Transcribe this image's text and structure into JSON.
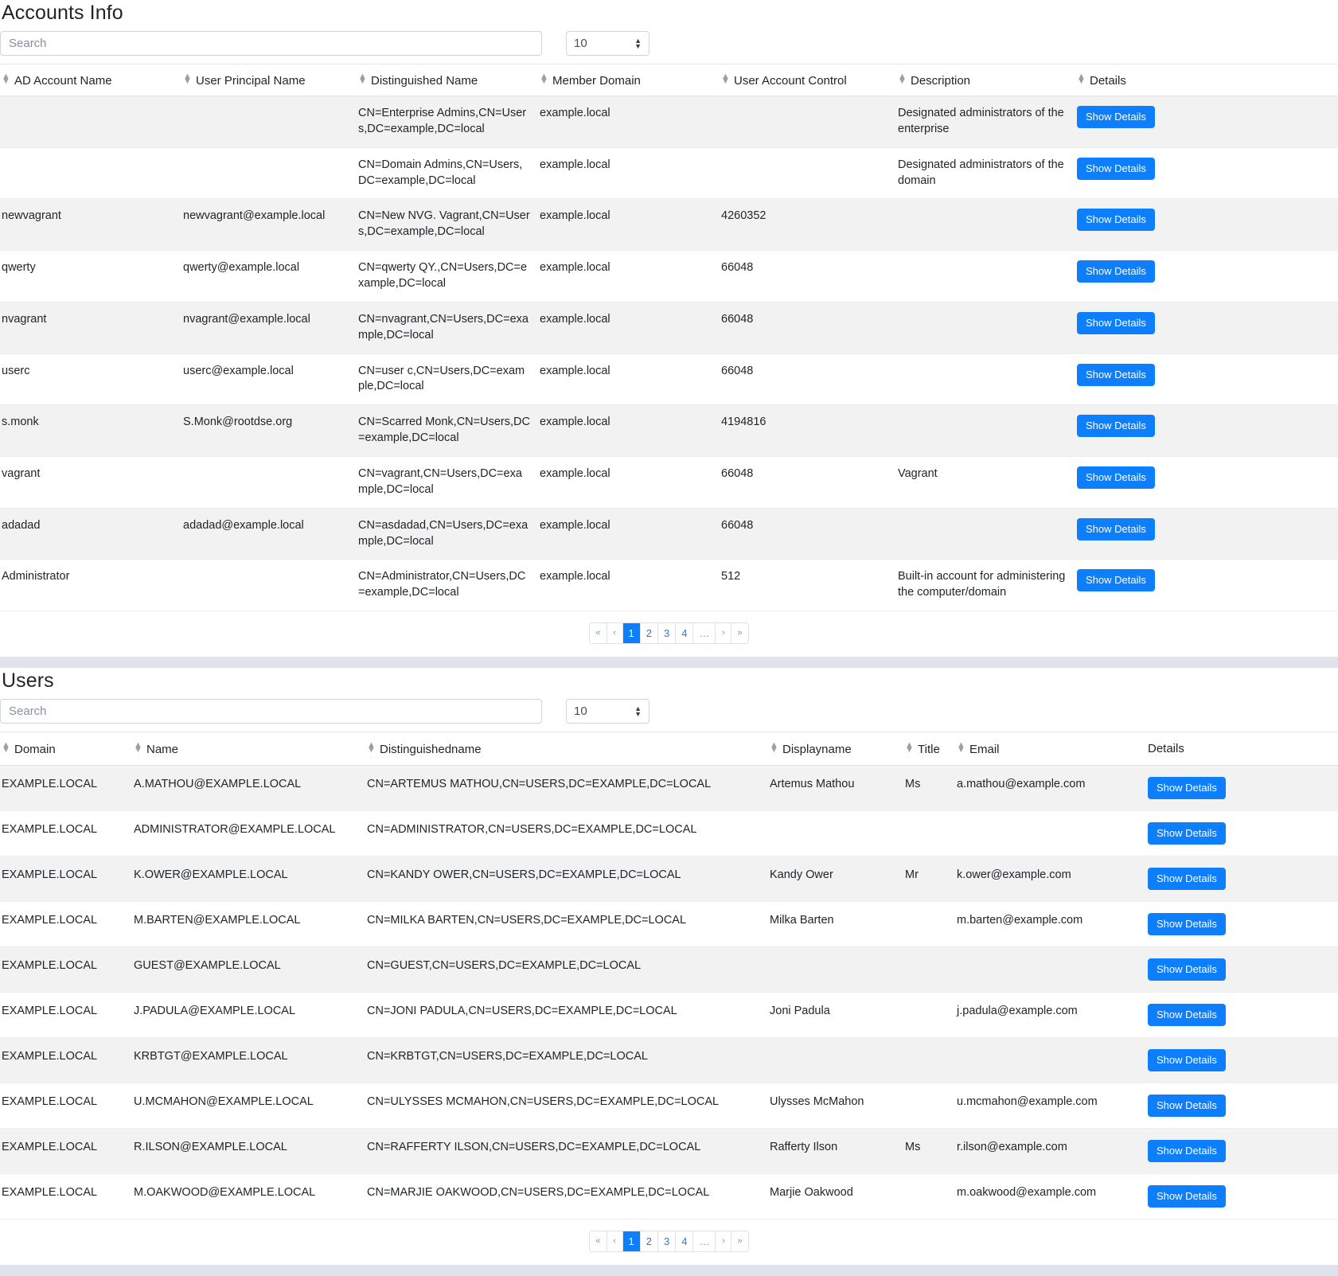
{
  "accounts": {
    "title": "Accounts Info",
    "search_placeholder": "Search",
    "page_size": "10",
    "columns": [
      "AD Account Name",
      "User Principal Name",
      "Distinguished Name",
      "Member Domain",
      "User Account Control",
      "Description",
      "Details"
    ],
    "details_label": "Show Details",
    "rows": [
      {
        "ad_account_name": "",
        "user_principal_name": "",
        "distinguished_name": "CN=Enterprise Admins,CN=Users,DC=example,DC=local",
        "member_domain": "example.local",
        "user_account_control": "",
        "description": "Designated administrators of the enterprise"
      },
      {
        "ad_account_name": "",
        "user_principal_name": "",
        "distinguished_name": "CN=Domain Admins,CN=Users,DC=example,DC=local",
        "member_domain": "example.local",
        "user_account_control": "",
        "description": "Designated administrators of the domain"
      },
      {
        "ad_account_name": "newvagrant",
        "user_principal_name": "newvagrant@example.local",
        "distinguished_name": "CN=New NVG. Vagrant,CN=Users,DC=example,DC=local",
        "member_domain": "example.local",
        "user_account_control": "4260352",
        "description": ""
      },
      {
        "ad_account_name": "qwerty",
        "user_principal_name": "qwerty@example.local",
        "distinguished_name": "CN=qwerty QY.,CN=Users,DC=example,DC=local",
        "member_domain": "example.local",
        "user_account_control": "66048",
        "description": ""
      },
      {
        "ad_account_name": "nvagrant",
        "user_principal_name": "nvagrant@example.local",
        "distinguished_name": "CN=nvagrant,CN=Users,DC=example,DC=local",
        "member_domain": "example.local",
        "user_account_control": "66048",
        "description": ""
      },
      {
        "ad_account_name": "userc",
        "user_principal_name": "userc@example.local",
        "distinguished_name": "CN=user c,CN=Users,DC=example,DC=local",
        "member_domain": "example.local",
        "user_account_control": "66048",
        "description": ""
      },
      {
        "ad_account_name": "s.monk",
        "user_principal_name": "S.Monk@rootdse.org",
        "distinguished_name": "CN=Scarred Monk,CN=Users,DC=example,DC=local",
        "member_domain": "example.local",
        "user_account_control": "4194816",
        "description": ""
      },
      {
        "ad_account_name": "vagrant",
        "user_principal_name": "",
        "distinguished_name": "CN=vagrant,CN=Users,DC=example,DC=local",
        "member_domain": "example.local",
        "user_account_control": "66048",
        "description": "Vagrant"
      },
      {
        "ad_account_name": "adadad",
        "user_principal_name": "adadad@example.local",
        "distinguished_name": "CN=asdadad,CN=Users,DC=example,DC=local",
        "member_domain": "example.local",
        "user_account_control": "66048",
        "description": ""
      },
      {
        "ad_account_name": "Administrator",
        "user_principal_name": "",
        "distinguished_name": "CN=Administrator,CN=Users,DC=example,DC=local",
        "member_domain": "example.local",
        "user_account_control": "512",
        "description": "Built-in account for administering the computer/domain"
      }
    ],
    "pagination": {
      "first": "«",
      "prev": "‹",
      "pages": [
        "1",
        "2",
        "3",
        "4"
      ],
      "ellipsis": "…",
      "next": "›",
      "last": "»",
      "active": "1"
    }
  },
  "users": {
    "title": "Users",
    "search_placeholder": "Search",
    "page_size": "10",
    "columns": [
      "Domain",
      "Name",
      "Distinguishedname",
      "Displayname",
      "Title",
      "Email",
      "Details"
    ],
    "details_label": "Show Details",
    "rows": [
      {
        "domain": "EXAMPLE.LOCAL",
        "name": "A.MATHOU@EXAMPLE.LOCAL",
        "distinguishedname": "CN=ARTEMUS MATHOU,CN=USERS,DC=EXAMPLE,DC=LOCAL",
        "displayname": "Artemus Mathou",
        "title": "Ms",
        "email": "a.mathou@example.com"
      },
      {
        "domain": "EXAMPLE.LOCAL",
        "name": "ADMINISTRATOR@EXAMPLE.LOCAL",
        "distinguishedname": "CN=ADMINISTRATOR,CN=USERS,DC=EXAMPLE,DC=LOCAL",
        "displayname": "",
        "title": "",
        "email": ""
      },
      {
        "domain": "EXAMPLE.LOCAL",
        "name": "K.OWER@EXAMPLE.LOCAL",
        "distinguishedname": "CN=KANDY OWER,CN=USERS,DC=EXAMPLE,DC=LOCAL",
        "displayname": "Kandy Ower",
        "title": "Mr",
        "email": "k.ower@example.com"
      },
      {
        "domain": "EXAMPLE.LOCAL",
        "name": "M.BARTEN@EXAMPLE.LOCAL",
        "distinguishedname": "CN=MILKA BARTEN,CN=USERS,DC=EXAMPLE,DC=LOCAL",
        "displayname": "Milka Barten",
        "title": "",
        "email": "m.barten@example.com"
      },
      {
        "domain": "EXAMPLE.LOCAL",
        "name": "GUEST@EXAMPLE.LOCAL",
        "distinguishedname": "CN=GUEST,CN=USERS,DC=EXAMPLE,DC=LOCAL",
        "displayname": "",
        "title": "",
        "email": ""
      },
      {
        "domain": "EXAMPLE.LOCAL",
        "name": "J.PADULA@EXAMPLE.LOCAL",
        "distinguishedname": "CN=JONI PADULA,CN=USERS,DC=EXAMPLE,DC=LOCAL",
        "displayname": "Joni Padula",
        "title": "",
        "email": "j.padula@example.com"
      },
      {
        "domain": "EXAMPLE.LOCAL",
        "name": "KRBTGT@EXAMPLE.LOCAL",
        "distinguishedname": "CN=KRBTGT,CN=USERS,DC=EXAMPLE,DC=LOCAL",
        "displayname": "",
        "title": "",
        "email": ""
      },
      {
        "domain": "EXAMPLE.LOCAL",
        "name": "U.MCMAHON@EXAMPLE.LOCAL",
        "distinguishedname": "CN=ULYSSES MCMAHON,CN=USERS,DC=EXAMPLE,DC=LOCAL",
        "displayname": "Ulysses McMahon",
        "title": "",
        "email": "u.mcmahon@example.com"
      },
      {
        "domain": "EXAMPLE.LOCAL",
        "name": "R.ILSON@EXAMPLE.LOCAL",
        "distinguishedname": "CN=RAFFERTY ILSON,CN=USERS,DC=EXAMPLE,DC=LOCAL",
        "displayname": "Rafferty Ilson",
        "title": "Ms",
        "email": "r.ilson@example.com"
      },
      {
        "domain": "EXAMPLE.LOCAL",
        "name": "M.OAKWOOD@EXAMPLE.LOCAL",
        "distinguishedname": "CN=MARJIE OAKWOOD,CN=USERS,DC=EXAMPLE,DC=LOCAL",
        "displayname": "Marjie Oakwood",
        "title": "",
        "email": "m.oakwood@example.com"
      }
    ],
    "pagination": {
      "first": "«",
      "prev": "‹",
      "pages": [
        "1",
        "2",
        "3",
        "4"
      ],
      "ellipsis": "…",
      "next": "›",
      "last": "»",
      "active": "1"
    }
  },
  "colors": {
    "accent": "#0d7ffc",
    "row_odd": "#f2f2f2",
    "panel_gap": "#dfe3ec"
  }
}
